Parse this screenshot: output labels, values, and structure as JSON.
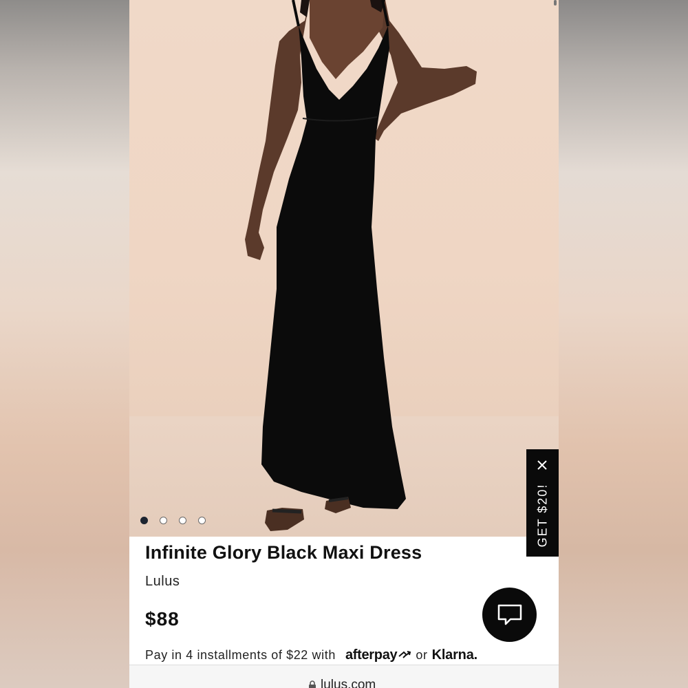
{
  "product": {
    "title": "Infinite Glory Black Maxi Dress",
    "brand": "Lulus",
    "price": "$88",
    "image_alt": "Model wearing black maxi dress"
  },
  "carousel": {
    "total": 4,
    "active_index": 0
  },
  "installments": {
    "text": "Pay in 4 installments of $22 with",
    "afterpay_label": "afterpay",
    "or_label": "or",
    "klarna_label": "Klarna."
  },
  "promo": {
    "label": "GET $20!",
    "close_icon": "close-icon"
  },
  "chat": {
    "icon": "chat-bubble-icon"
  },
  "browser": {
    "url": "lulus.com",
    "lock_icon": "lock-icon"
  },
  "colors": {
    "accent": "#0a0a0a",
    "background": "#efd6c4"
  }
}
